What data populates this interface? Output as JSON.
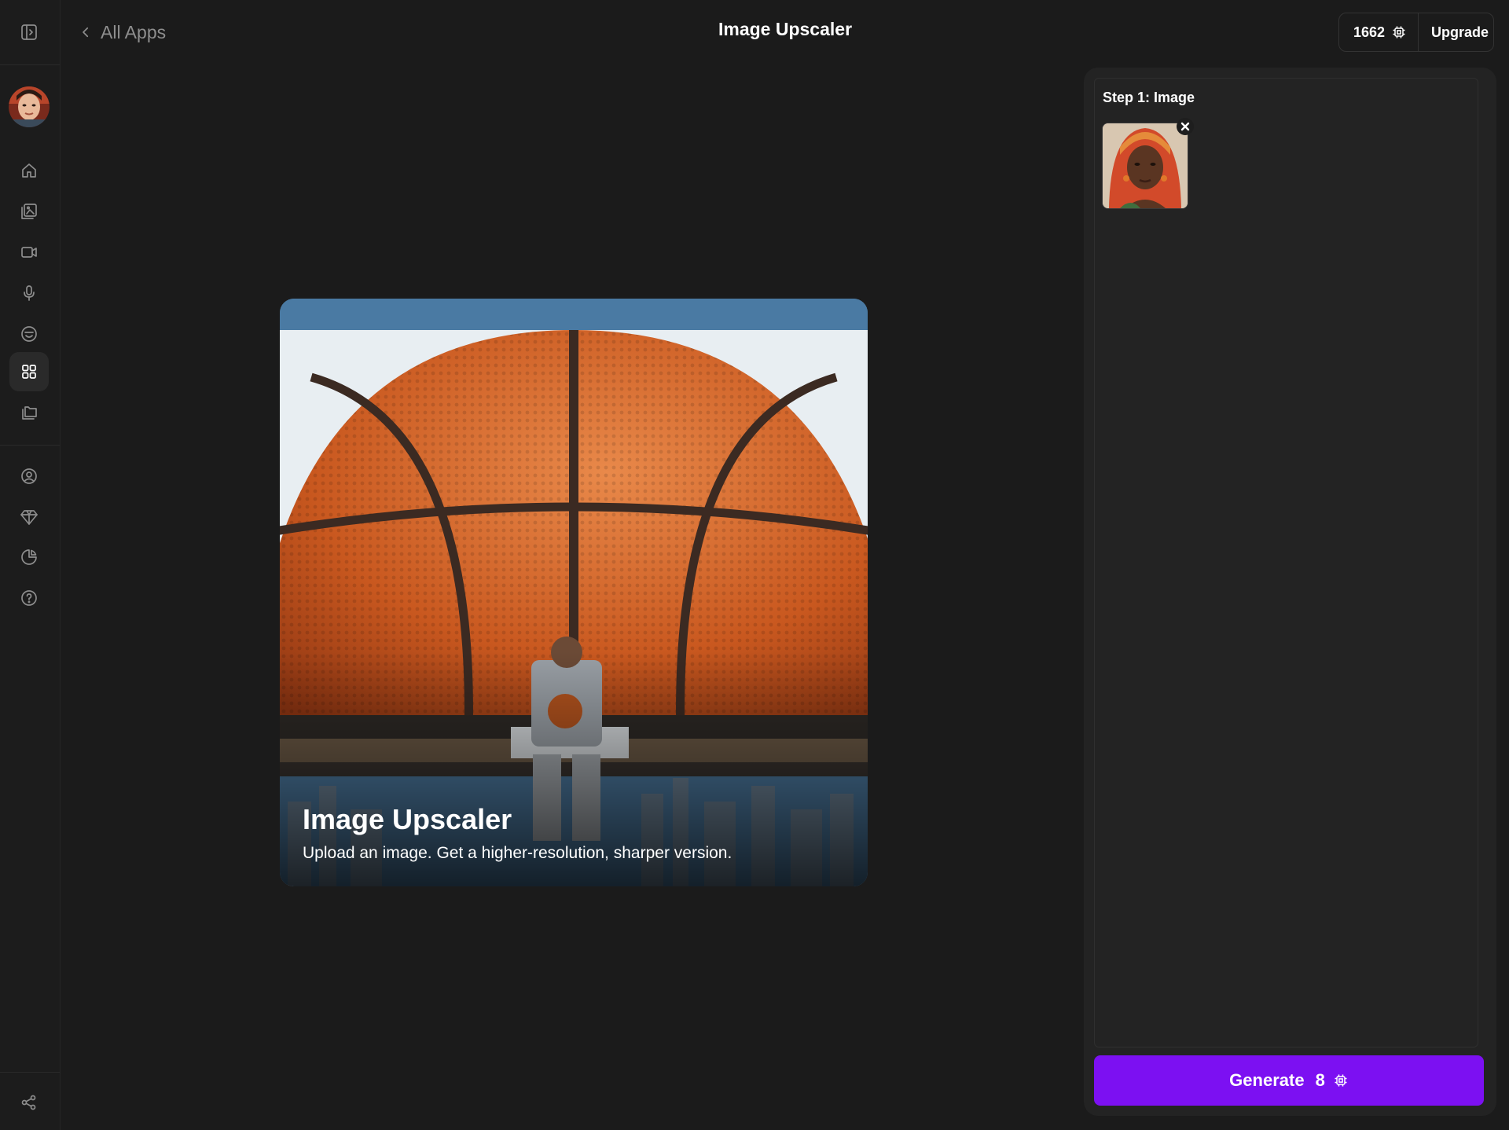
{
  "header": {
    "back_label": "All Apps",
    "title": "Image Upscaler",
    "credits": "1662",
    "upgrade_label": "Upgrade"
  },
  "sidebar": {
    "items": [
      {
        "name": "home-icon"
      },
      {
        "name": "image-gallery-icon"
      },
      {
        "name": "video-icon"
      },
      {
        "name": "microphone-icon"
      },
      {
        "name": "face-icon"
      },
      {
        "name": "apps-grid-icon",
        "active": true
      },
      {
        "name": "folders-icon"
      },
      {
        "name": "profile-icon"
      },
      {
        "name": "diamond-icon"
      },
      {
        "name": "usage-chart-icon"
      },
      {
        "name": "help-icon"
      },
      {
        "name": "share-icon"
      }
    ]
  },
  "hero": {
    "title": "Image Upscaler",
    "subtitle": "Upload an image. Get a higher-resolution, sharper version."
  },
  "panel": {
    "step_label": "Step 1: Image",
    "generate_label": "Generate",
    "generate_cost": "8"
  },
  "colors": {
    "background": "#1b1b1b",
    "accent": "#7c10f2",
    "panel": "#232323"
  }
}
